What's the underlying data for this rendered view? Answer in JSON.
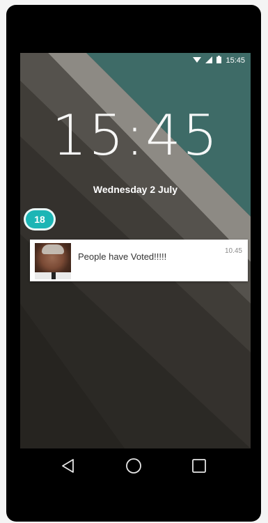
{
  "status_bar": {
    "time": "15:45",
    "icons": [
      "wifi-icon",
      "signal-icon",
      "battery-icon"
    ]
  },
  "lockscreen": {
    "clock": "15:45",
    "date": "Wednesday 2 July"
  },
  "badge": {
    "count": "18",
    "color": "#1cb5b5"
  },
  "notification": {
    "text": "People have Voted!!!!!",
    "time": "10.45",
    "avatar": "avatar-photo"
  },
  "nav_bar": {
    "buttons": [
      "back-icon",
      "home-icon",
      "recents-icon"
    ]
  },
  "colors": {
    "teal_background": "#3b6e6a",
    "screen_dark": "#363430"
  }
}
